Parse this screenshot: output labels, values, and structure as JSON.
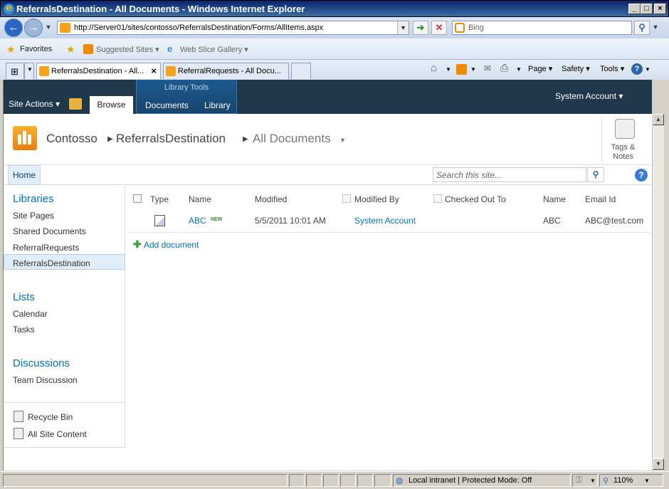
{
  "window": {
    "title": "ReferralsDestination - All Documents - Windows Internet Explorer"
  },
  "nav": {
    "url": "http://Server01/sites/contosso/ReferralsDestination/Forms/AllItems.aspx",
    "search_placeholder": "Bing"
  },
  "favorites": {
    "label": "Favorites",
    "suggested": "Suggested Sites ▾",
    "webslice": "Web Slice Gallery ▾"
  },
  "tabs": [
    {
      "label": "ReferralsDestination - All..."
    },
    {
      "label": "ReferralRequests - All Docu..."
    }
  ],
  "commands": {
    "page": "Page ▾",
    "safety": "Safety ▾",
    "tools": "Tools ▾"
  },
  "ribbon": {
    "site_actions": "Site Actions ▾",
    "browse": "Browse",
    "library_tools": "Library Tools",
    "documents": "Documents",
    "library": "Library",
    "account": "System Account ▾"
  },
  "breadcrumb": {
    "site": "Contosso",
    "list": "ReferralsDestination",
    "view": "All Documents"
  },
  "tags": {
    "line1": "Tags &",
    "line2": "Notes"
  },
  "topnav": {
    "home": "Home",
    "search_placeholder": "Search this site..."
  },
  "quicklaunch": {
    "libraries": {
      "heading": "Libraries",
      "items": [
        "Site Pages",
        "Shared Documents",
        "ReferralRequests",
        "ReferralsDestination"
      ]
    },
    "lists": {
      "heading": "Lists",
      "items": [
        "Calendar",
        "Tasks"
      ]
    },
    "discussions": {
      "heading": "Discussions",
      "items": [
        "Team Discussion"
      ]
    },
    "bottom": [
      "Recycle Bin",
      "All Site Content"
    ]
  },
  "table": {
    "headers": {
      "type": "Type",
      "name": "Name",
      "modified": "Modified",
      "modified_by": "Modified By",
      "checked_out": "Checked Out To",
      "name2": "Name",
      "email": "Email Id"
    },
    "rows": [
      {
        "name": "ABC",
        "new_badge": "NEW",
        "modified": "5/5/2011 10:01 AM",
        "modified_by": "System Account",
        "name2": "ABC",
        "email": "ABC@test.com"
      }
    ],
    "add_document": "Add document"
  },
  "status": {
    "zone": "Local intranet | Protected Mode: Off",
    "zoom": "110%"
  }
}
